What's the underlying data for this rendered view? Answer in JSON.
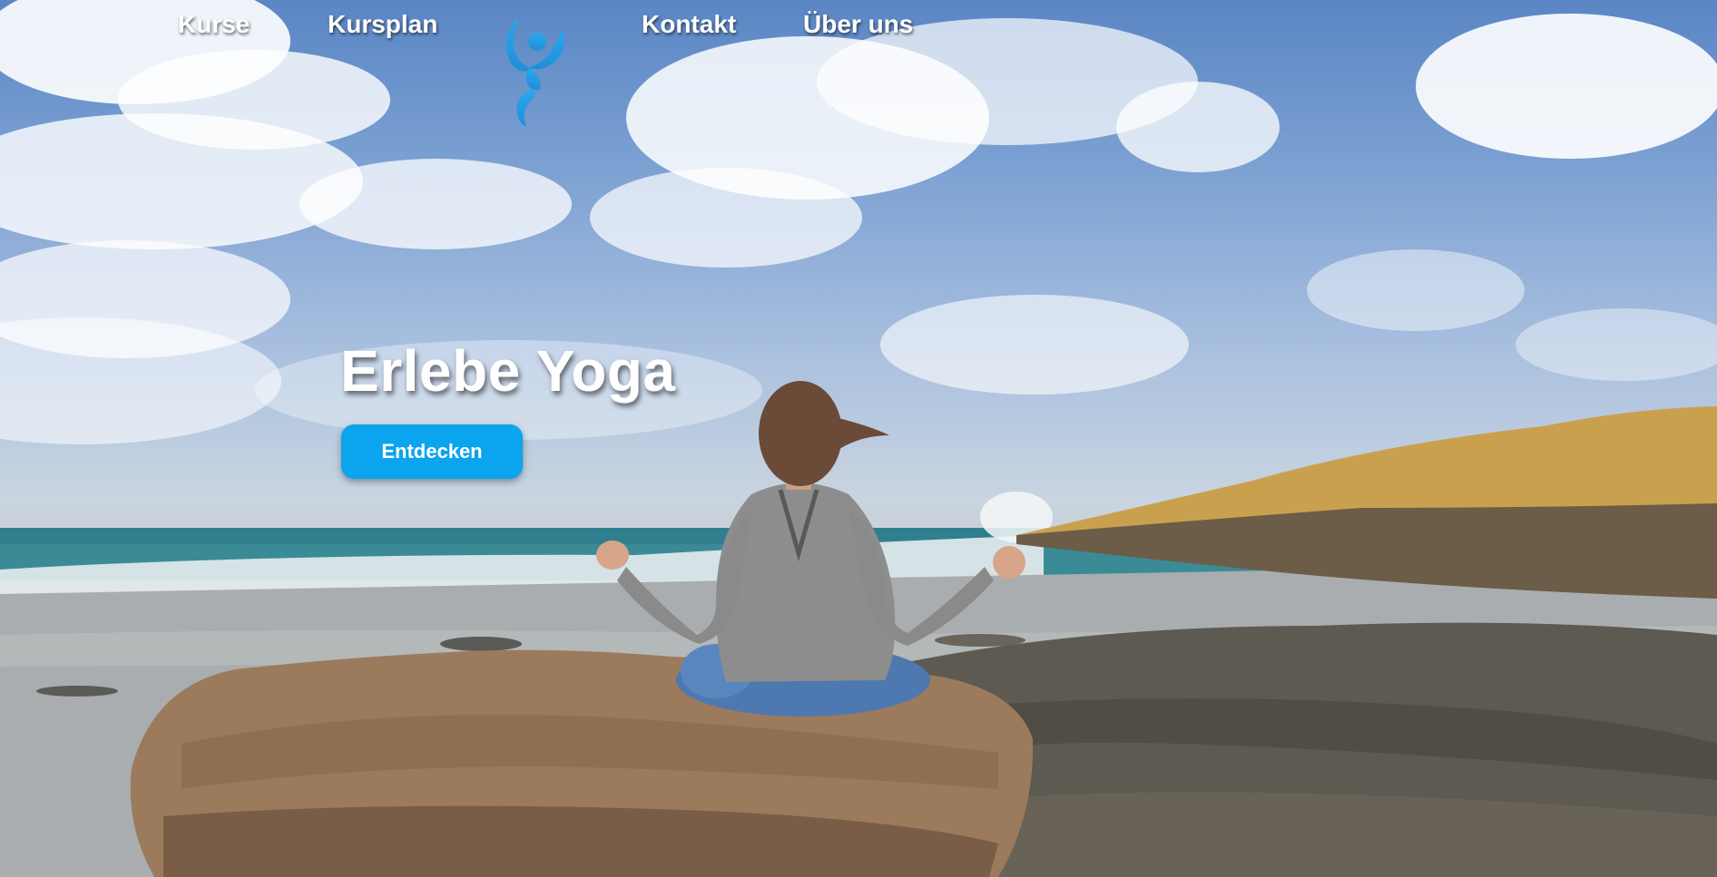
{
  "nav": {
    "items": [
      {
        "label": "Kurse"
      },
      {
        "label": "Kursplan"
      },
      {
        "label": "Kontakt"
      },
      {
        "label": "Über uns"
      }
    ]
  },
  "logo": {
    "icon": "yoga-figure-logo-icon",
    "color": "#1e9fe6"
  },
  "hero": {
    "headline": "Erlebe Yoga",
    "cta_label": "Entdecken",
    "cta_color": "#0aa4ef",
    "image": "woman-meditating-on-rock-by-sea"
  }
}
